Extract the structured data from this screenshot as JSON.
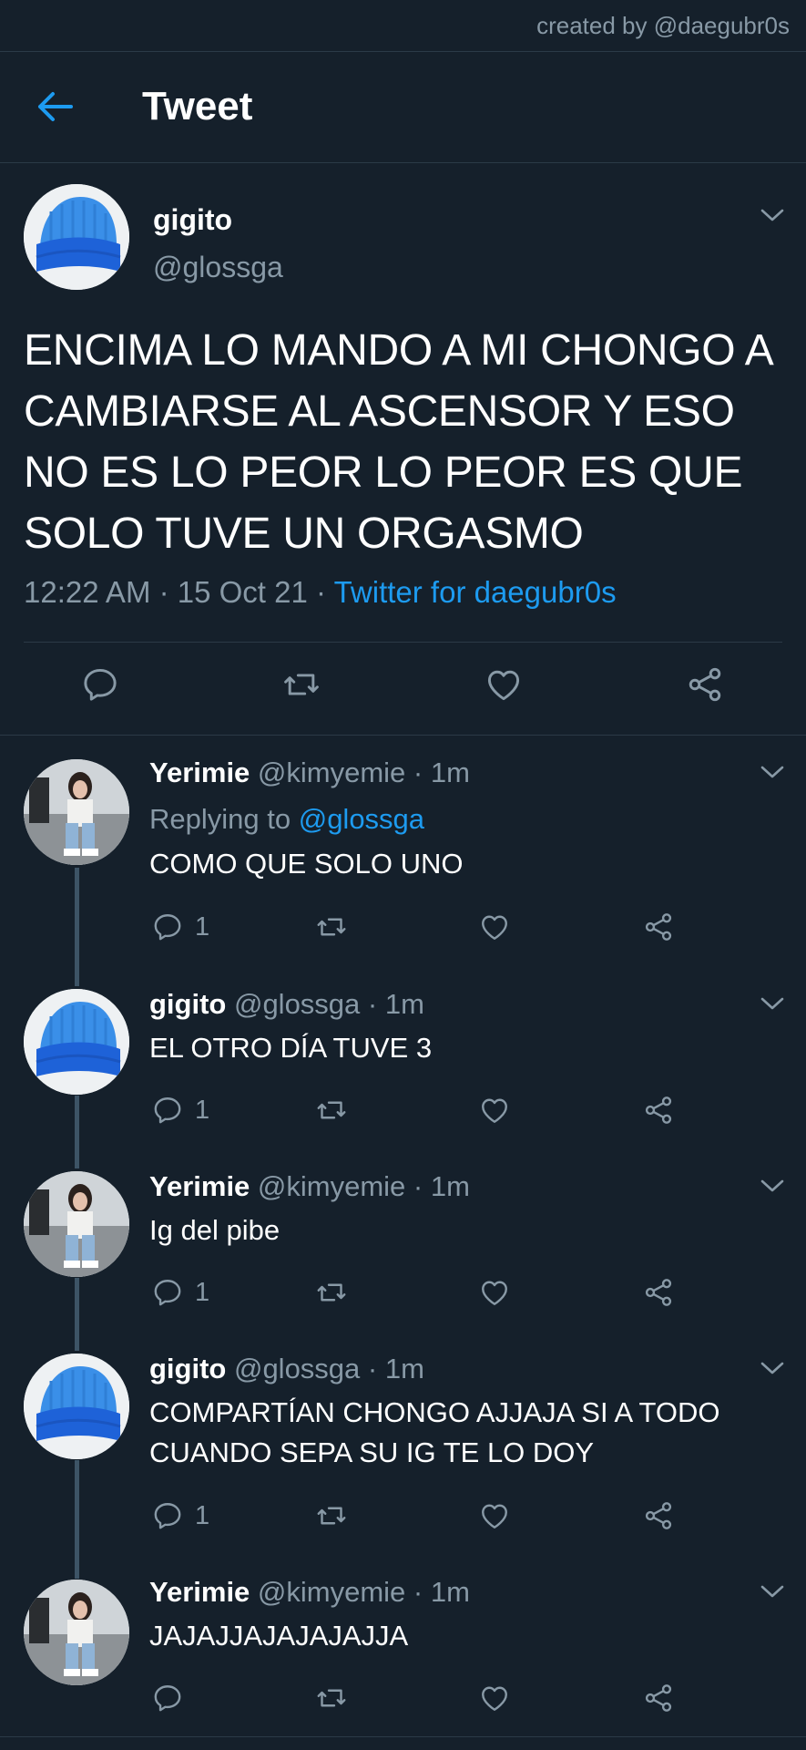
{
  "credit": "created by @daegubr0s",
  "header": {
    "title": "Tweet"
  },
  "tweet": {
    "name": "gigito",
    "handle": "@glossga",
    "text": "ENCIMA LO MANDO A MI CHONGO A CAMBIARSE AL ASCENSOR Y ESO NO ES LO PEOR LO PEOR ES QUE SOLO TUVE UN ORGASMO",
    "time_date": "12:22 AM · 15 Oct 21 · ",
    "source": "Twitter for daegubr0s"
  },
  "replies": [
    {
      "name": "Yerimie",
      "handle": " @kimyemie · 1m",
      "replying_prefix": "Replying to ",
      "replying_to": "@glossga",
      "text": "COMO QUE SOLO UNO",
      "reply_count": "1"
    },
    {
      "name": "gigito",
      "handle": " @glossga · 1m",
      "text": "EL OTRO DÍA TUVE 3",
      "reply_count": "1"
    },
    {
      "name": "Yerimie",
      "handle": " @kimyemie · 1m",
      "text": "Ig del pibe",
      "reply_count": "1"
    },
    {
      "name": "gigito",
      "handle": " @glossga · 1m",
      "text": "COMPARTÍAN CHONGO AJJAJA SI A TODO CUANDO SEPA SU IG TE LO DOY",
      "reply_count": "1"
    },
    {
      "name": "Yerimie",
      "handle": " @kimyemie · 1m",
      "text": "JAJAJJAJAJAJAJJA",
      "reply_count": ""
    }
  ],
  "colors": {
    "background": "#15202b",
    "accent": "#1d9bf0",
    "muted": "#8899a6"
  },
  "icons": [
    "back-arrow-icon",
    "chevron-down-icon",
    "reply-icon",
    "retweet-icon",
    "like-icon",
    "share-icon"
  ]
}
